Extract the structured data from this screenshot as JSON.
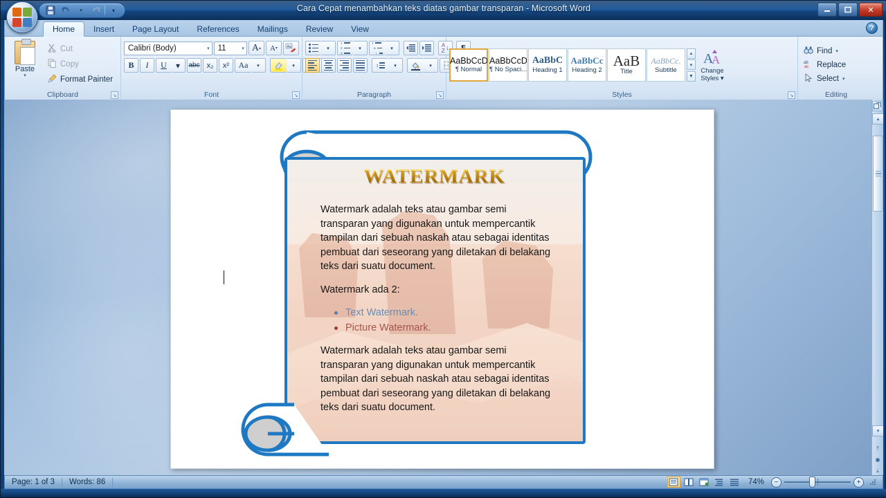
{
  "window": {
    "title": "Cara Cepat menambahkan teks diatas gambar transparan  -  Microsoft Word",
    "minimize_label": "–",
    "restore_label": "❑",
    "close_label": "✕",
    "help_label": "?"
  },
  "quick_access": {
    "save_label": "💾",
    "undo_label": "↶",
    "undo_caret": "▾",
    "redo_label": "↷",
    "customize_label": "▾"
  },
  "tabs": [
    {
      "label": "Home",
      "active": true
    },
    {
      "label": "Insert",
      "active": false
    },
    {
      "label": "Page Layout",
      "active": false
    },
    {
      "label": "References",
      "active": false
    },
    {
      "label": "Mailings",
      "active": false
    },
    {
      "label": "Review",
      "active": false
    },
    {
      "label": "View",
      "active": false
    }
  ],
  "ribbon": {
    "clipboard": {
      "label": "Clipboard",
      "paste_label": "Paste",
      "paste_caret": "▾",
      "cut_label": "Cut",
      "copy_label": "Copy",
      "format_painter_label": "Format Painter",
      "dialog_launcher": "↘"
    },
    "font": {
      "label": "Font",
      "font_name": "Calibri (Body)",
      "font_size": "11",
      "grow_font": "A",
      "shrink_font": "A",
      "clear_formatting": "Aa",
      "bold": "B",
      "italic": "I",
      "underline": "U",
      "strikethrough": "abc",
      "subscript": "x₂",
      "superscript": "x²",
      "change_case": "Aa",
      "highlight": "ab",
      "font_color": "A",
      "caret": "▾",
      "dialog_launcher": "↘"
    },
    "paragraph": {
      "label": "Paragraph",
      "bullets": "bullets",
      "numbering": "numbering",
      "multilevel": "multilevel",
      "decrease_indent": "⇤",
      "increase_indent": "⇥",
      "sort": "A↓",
      "show_marks": "¶",
      "align_left": "align-left",
      "align_center": "align-center",
      "align_right": "align-right",
      "justify": "justify",
      "line_spacing": "↕",
      "shading": "shading",
      "borders": "borders",
      "caret": "▾",
      "dialog_launcher": "↘"
    },
    "styles": {
      "label": "Styles",
      "items": [
        {
          "sample": "AaBbCcDc",
          "name": "¶ Normal",
          "active": true
        },
        {
          "sample": "AaBbCcDc",
          "name": "¶ No Spaci...",
          "active": false
        },
        {
          "sample": "AaBbC",
          "name": "Heading 1",
          "active": false
        },
        {
          "sample": "AaBbCc",
          "name": "Heading 2",
          "active": false
        },
        {
          "sample": "AaB",
          "name": "Title",
          "active": false
        },
        {
          "sample": "AaBbCc.",
          "name": "Subtitle",
          "active": false
        }
      ],
      "scroll_up": "▴",
      "scroll_down": "▾",
      "more": "▼",
      "change_styles_line1": "Change",
      "change_styles_line2": "Styles ▾",
      "dialog_launcher": "↘"
    },
    "editing": {
      "label": "Editing",
      "find_label": "Find",
      "find_caret": "▾",
      "replace_label": "Replace",
      "select_label": "Select",
      "select_caret": "▾"
    }
  },
  "document": {
    "wordart_title": "WATERMARK",
    "paragraph1": "Watermark adalah teks atau gambar semi transparan yang digunakan untuk mempercantik tampilan dari sebuah naskah atau sebagai identitas pembuat dari seseorang yang diletakan di belakang teks dari suatu document.",
    "list_intro": "Watermark ada 2:",
    "bullet_text": "Text Watermark.",
    "bullet_picture": "Picture Watermark.",
    "paragraph2": "Watermark adalah teks atau gambar semi transparan yang digunakan untuk mempercantik tampilan dari sebuah naskah atau sebagai identitas pembuat dari seseorang yang diletakan di belakang teks dari suatu document.",
    "colors": {
      "wordart_gold": "#f6c83c",
      "bullet_text_color": "#6b8db2",
      "bullet_picture_color": "#a4544c",
      "scroll_outline": "#1f78c2"
    }
  },
  "status_bar": {
    "page_label": "Page: 1 of 3",
    "words_label": "Words: 86",
    "zoom_label": "74%",
    "zoom_out": "−",
    "zoom_in": "+",
    "views": [
      {
        "name": "print-layout",
        "glyph": "▤",
        "active": true
      },
      {
        "name": "full-screen-reading",
        "glyph": "◫",
        "active": false
      },
      {
        "name": "web-layout",
        "glyph": "▧",
        "active": false
      },
      {
        "name": "outline",
        "glyph": "≡",
        "active": false
      },
      {
        "name": "draft",
        "glyph": "☰",
        "active": false
      }
    ]
  },
  "scrollbar": {
    "up_arrow": "▴",
    "down_arrow": "▾",
    "browse_prev": "⤒",
    "browse_object": "◉",
    "browse_next": "⤓",
    "split_handle": "▬"
  }
}
